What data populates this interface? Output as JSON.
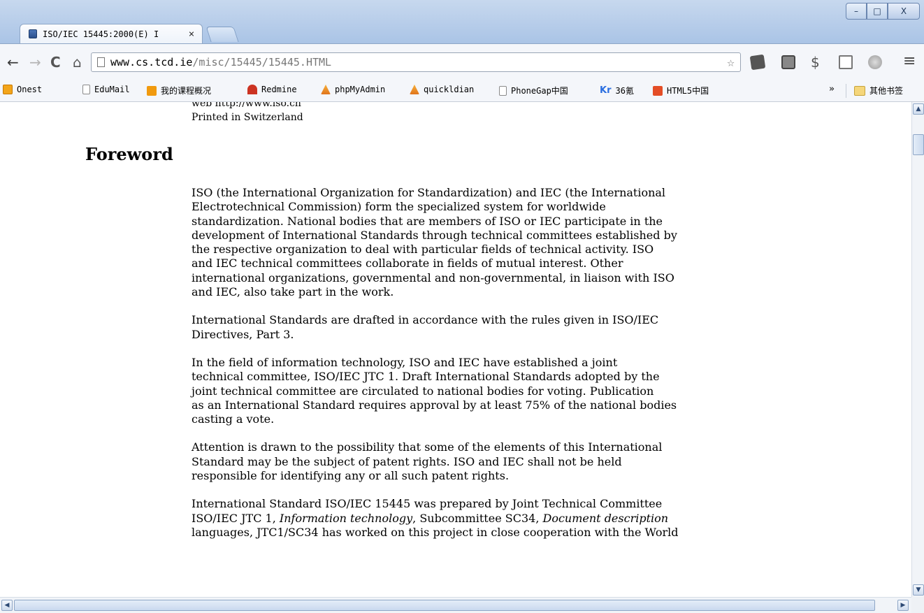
{
  "tab": {
    "title": "ISO/IEC 15445:2000(E) I",
    "close": "×"
  },
  "window_controls": {
    "minimize": "–",
    "maximize": "□",
    "close": "X"
  },
  "toolbar": {
    "back": "←",
    "forward": "→",
    "reload": "C",
    "home": "⌂",
    "star": "☆",
    "menu": "≡"
  },
  "address": {
    "host": "www.cs.tcd.ie",
    "path": "/misc/15445/15445.HTML"
  },
  "bookmarks": {
    "items": [
      {
        "label": "Onest",
        "icon": "onest-icon"
      },
      {
        "label": "EduMail",
        "icon": "page-icon"
      },
      {
        "label": "我的课程概况",
        "icon": "mn-icon"
      },
      {
        "label": "Redmine",
        "icon": "redmine-icon"
      },
      {
        "label": "phpMyAdmin",
        "icon": "pma-icon"
      },
      {
        "label": "quickldian",
        "icon": "pma-icon"
      },
      {
        "label": "PhoneGap中国",
        "icon": "page-icon"
      },
      {
        "label": "36氪",
        "icon": "kr-icon",
        "prefix": "Kr"
      },
      {
        "label": "HTML5中国",
        "icon": "html5-icon"
      }
    ],
    "more": "»",
    "other": "其他书签"
  },
  "page": {
    "printed_top": "web  http://www.iso.ch",
    "printed": "Printed in Switzerland",
    "heading": "Foreword",
    "p1": "ISO (the International Organization for Standardization) and IEC (the International\nElectrotechnical Commission) form the specialized system for worldwide\nstandardization. National bodies that are members of ISO or IEC participate in the\ndevelopment of International Standards through technical committees established by\nthe respective organization to deal with particular fields of technical activity. ISO\nand IEC technical committees collaborate in fields of mutual interest. Other\ninternational organizations, governmental and non-governmental, in liaison with ISO\nand IEC, also take part in the work.",
    "p2": "International Standards are drafted in accordance with the rules given in ISO/IEC\nDirectives, Part 3.",
    "p3": "In the field of information technology, ISO and IEC have established a joint\ntechnical committee, ISO/IEC JTC 1. Draft International Standards adopted by the\njoint technical committee are circulated to national bodies for voting. Publication\nas an International Standard requires approval by at least 75% of the national bodies\ncasting a vote.",
    "p4": "Attention is drawn to the possibility that some of the elements of this International\nStandard may be the subject of patent rights. ISO and IEC shall not be held\nresponsible for identifying any or all such patent rights.",
    "p5_a": "International Standard ISO/IEC 15445 was prepared by Joint Technical Committee\nISO/IEC JTC 1, ",
    "p5_em1": "Information technology",
    "p5_b": ", Subcommittee SC34, ",
    "p5_em2": "Document description",
    "p5_c": "\nlanguages, JTC1/SC34 has worked on this project in close cooperation with the World"
  },
  "scrollbars": {
    "up": "▲",
    "down": "▼",
    "left": "◀",
    "right": "▶"
  }
}
